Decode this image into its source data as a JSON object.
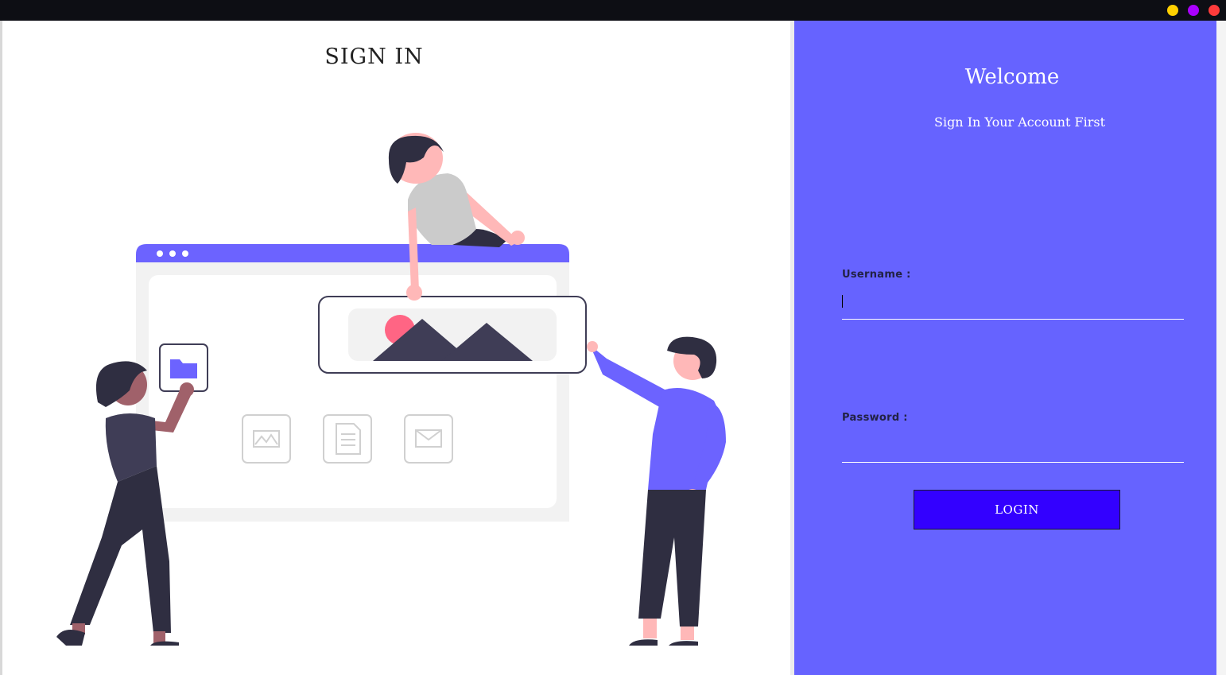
{
  "window": {
    "controls": [
      {
        "name": "minimize",
        "color": "#ffd000"
      },
      {
        "name": "maximize",
        "color": "#aa00ff"
      },
      {
        "name": "close",
        "color": "#ff3b3b"
      }
    ]
  },
  "left": {
    "title": "SIGN IN",
    "illustration": "people-arranging-webpage-illustration"
  },
  "right": {
    "heading": "Welcome",
    "subheading": "Sign In Your Account First",
    "username_label": "Username :",
    "username_value": "",
    "password_label": "Password :",
    "password_value": "",
    "login_label": "LOGIN"
  },
  "colors": {
    "panel": "#6663ff",
    "button": "#3300ff",
    "accent": "#6c63ff",
    "titlebar": "#0d0e14"
  }
}
